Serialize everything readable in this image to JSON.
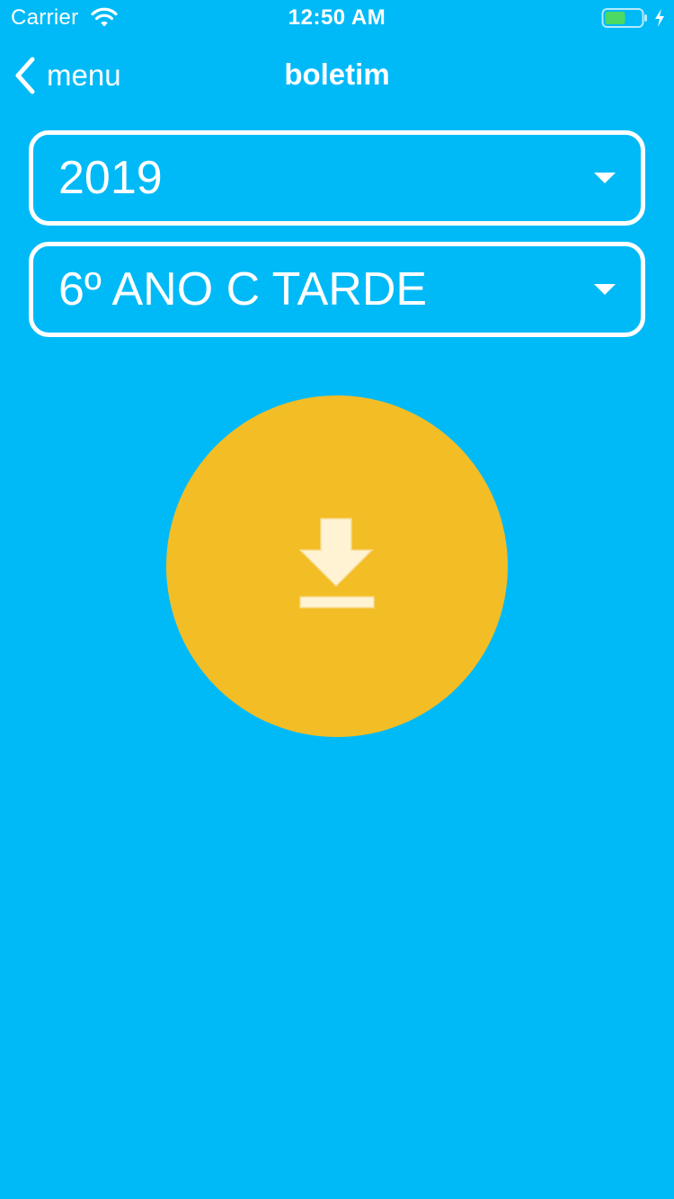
{
  "status_bar": {
    "carrier": "Carrier",
    "time": "12:50 AM",
    "wifi_icon": "wifi-icon",
    "battery_icon": "battery-icon",
    "charging_icon": "charging-bolt-icon",
    "battery_color": "#4CD964"
  },
  "nav": {
    "back_label": "menu",
    "back_icon": "chevron-left-icon",
    "title": "boletim"
  },
  "filters": {
    "year": {
      "selected": "2019",
      "icon": "caret-down-icon"
    },
    "class": {
      "selected": "6º ANO C TARDE",
      "icon": "caret-down-icon"
    }
  },
  "download": {
    "icon": "download-icon"
  },
  "colors": {
    "background": "#00BAF7",
    "accent": "#F3BD26",
    "icon_fill": "#FFF3D4",
    "text": "#FFFFFF"
  }
}
